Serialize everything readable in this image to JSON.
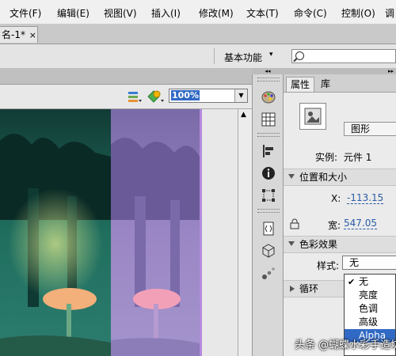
{
  "menubar": {
    "items": [
      "文件(F)",
      "编辑(E)",
      "视图(V)",
      "插入(I)",
      "修改(M)",
      "文本(T)",
      "命令(C)",
      "控制(O)",
      "调"
    ]
  },
  "document_tab": {
    "title": "名-1*",
    "close": "×"
  },
  "workspace": {
    "label": "基本功能",
    "arrow": "▾"
  },
  "search": {
    "value": ""
  },
  "stage_toolbar": {
    "zoom_value": "100%"
  },
  "panel": {
    "tabs": [
      "属性",
      "库"
    ],
    "symbol_type": "图形",
    "instance_label": "实例:",
    "instance_value": "元件 1",
    "position_size": {
      "heading": "位置和大小",
      "x_label": "X:",
      "x_value": "-113.15",
      "width_label": "宽:",
      "width_value": "547.05"
    },
    "color_effect": {
      "heading": "色彩效果",
      "style_label": "样式:",
      "style_value": "无"
    },
    "loop": {
      "heading": "循环"
    }
  },
  "style_dropdown": {
    "options": [
      "无",
      "亮度",
      "色调",
      "高级",
      "Alpha"
    ],
    "checked": "无",
    "highlighted": "Alpha"
  },
  "watermark": "头条 @蝴蝶水彩手造坊",
  "colors": {
    "accent": "#316ac5",
    "link_value": "#2a5ca8",
    "stage_dark": "#0b3b34",
    "stage_purple": "#8a7ab8"
  }
}
